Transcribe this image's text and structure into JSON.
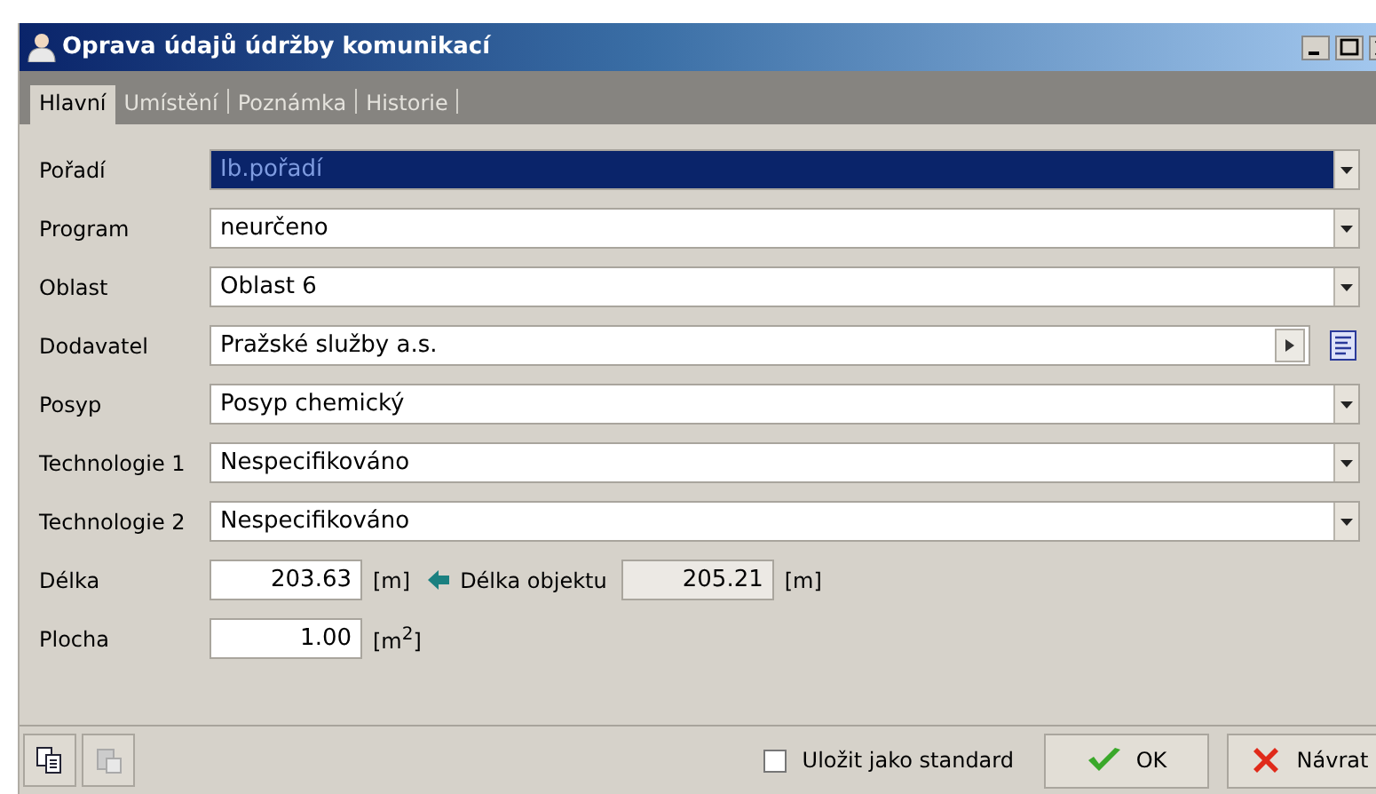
{
  "window": {
    "title": "Oprava údajů údržby komunikací"
  },
  "tabs": [
    {
      "label": "Hlavní",
      "selected": true
    },
    {
      "label": "Umístění",
      "selected": false
    },
    {
      "label": "Poznámka",
      "selected": false
    },
    {
      "label": "Historie",
      "selected": false
    }
  ],
  "fields": [
    {
      "label": "Pořadí",
      "kind": "combo",
      "value": "Ib.pořadí",
      "highlighted": true
    },
    {
      "label": "Program",
      "kind": "combo",
      "value": "neurčeno",
      "highlighted": false
    },
    {
      "label": "Oblast",
      "kind": "combo",
      "value": "Oblast 6",
      "highlighted": false
    },
    {
      "label": "Dodavatel",
      "kind": "lookup",
      "value": "Pražské služby a.s.",
      "highlighted": false
    },
    {
      "label": "Posyp",
      "kind": "combo",
      "value": "Posyp chemický",
      "highlighted": false
    },
    {
      "label": "Technologie 1",
      "kind": "combo",
      "value": "Nespecifikováno",
      "highlighted": false
    },
    {
      "label": "Technologie 2",
      "kind": "combo",
      "value": "Nespecifikováno",
      "highlighted": false
    }
  ],
  "length": {
    "label": "Délka",
    "value": "203.63",
    "unit": "[m]",
    "object_label": "Délka objektu",
    "object_value": "205.21",
    "object_unit": "[m]"
  },
  "area": {
    "label": "Plocha",
    "value": "1.00",
    "unit": "[m$^{2}$]"
  },
  "footer": {
    "save_default": {
      "label": "Uložit jako standard",
      "checked": false
    },
    "ok": "OK",
    "cancel": "Návrat"
  }
}
